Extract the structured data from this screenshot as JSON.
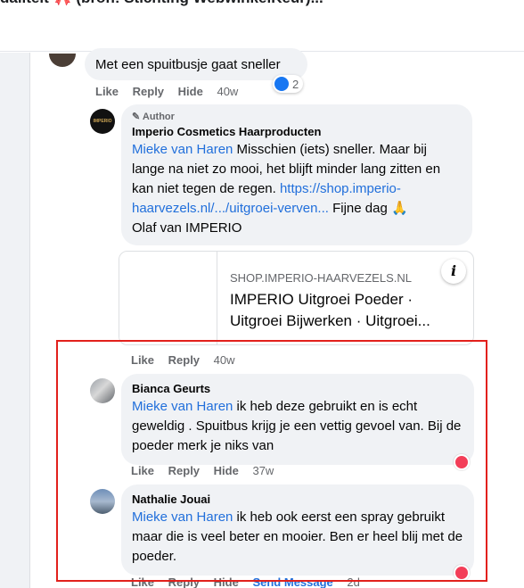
{
  "header": {
    "title": "daliteit 🎀 (bron: Stichting WebwinkelKeur)..."
  },
  "comment_top": {
    "text": "Met een spuitbusje gaat sneller",
    "actions": {
      "like": "Like",
      "reply": "Reply",
      "hide": "Hide",
      "time": "40w"
    },
    "reaction_count": "2"
  },
  "author_reply": {
    "badge": "Author",
    "name": "Imperio Cosmetics Haarproducten",
    "mention": "Mieke van Haren",
    "text1": " Misschien (iets) sneller. Maar bij lange na niet zo mooi, het blijft minder lang zitten en kan niet tegen de regen. ",
    "link": "https://shop.imperio-haarvezels.nl/.../uitgroei-verven...",
    "text2": " Fijne dag 🙏",
    "signature": "Olaf van IMPERIO",
    "avatar_text": "IMPERIO",
    "link_preview": {
      "domain": "SHOP.IMPERIO-HAARVEZELS.NL",
      "title": "IMPERIO Uitgroei Poeder · Uitgroei Bijwerken · Uitgroei...",
      "info_label": "i"
    },
    "actions": {
      "like": "Like",
      "reply": "Reply",
      "time": "40w"
    }
  },
  "comment_bianca": {
    "name": "Bianca Geurts",
    "mention": "Mieke van Haren",
    "text": " ik heb deze gebruikt en is echt geweldig . Spuitbus krijg je een vettig gevoel van. Bij de poeder merk je niks van",
    "actions": {
      "like": "Like",
      "reply": "Reply",
      "hide": "Hide",
      "time": "37w"
    }
  },
  "comment_nathalie": {
    "name": "Nathalie Jouai",
    "mention": "Mieke van Haren",
    "text": " ik heb ook eerst een spray gebruikt maar die is veel beter en mooier. Ben er heel blij met de poeder.",
    "actions": {
      "like": "Like",
      "reply": "Reply",
      "hide": "Hide",
      "send": "Send Message",
      "time": "2d"
    }
  },
  "colors": {
    "accent": "#216fdb",
    "highlight": "#e2201c",
    "heart": "#f33e58",
    "like": "#1877f2"
  }
}
